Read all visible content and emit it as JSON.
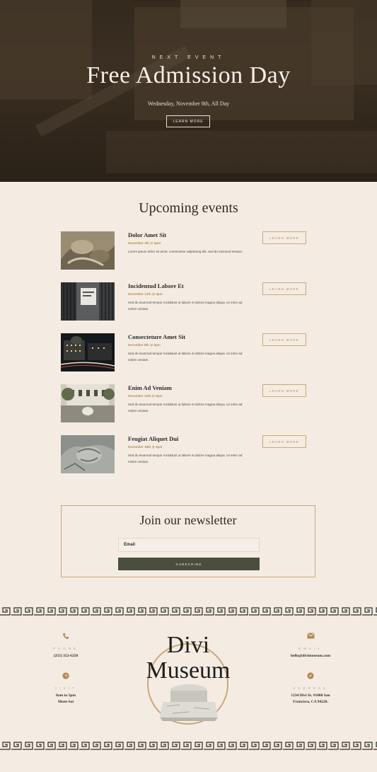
{
  "hero": {
    "kicker": "NEXT EVENT",
    "title": "Free Admission Day",
    "subtitle": "Wednesday, November 8th, All Day",
    "button": "LEARN MORE"
  },
  "events_section": {
    "title": "Upcoming events",
    "items": [
      {
        "name": "Dolor Amet Sit",
        "date": "November 4th @ 5pm",
        "desc": "Lorem ipsum dolor sit amet, consectetur adipiscing elit, sed do eiusmod tempor.",
        "button": "LEARN MORE"
      },
      {
        "name": "Incidentud Labore Et",
        "date": "November 12th @ 5pm",
        "desc": "Sed do eiusmod tempor incididunt ut labore et dolore magna aliqua. Ut enim ad minim veniam.",
        "button": "LEARN MORE"
      },
      {
        "name": "Consecteture Amet Sit",
        "date": "December 8th @ 5pm",
        "desc": "Sed do eiusmod tempor incididunt ut labore et dolore magna aliqua. Ut enim ad minim veniam.",
        "button": "LEARN MORE"
      },
      {
        "name": "Enim Ad Veniam",
        "date": "December 12th @ 5pm",
        "desc": "Sed do eiusmod tempor incididunt ut labore et dolore magna aliqua. Ut enim ad minim veniam.",
        "button": "LEARN MORE"
      },
      {
        "name": "Feugiat Aliquet Dui",
        "date": "December 18th @ 5pm",
        "desc": "Sed do eiusmod tempor incididunt ut labore et dolore magna aliqua. Ut enim ad minim veniam.",
        "button": "LEARN MORE"
      }
    ]
  },
  "newsletter": {
    "title": "Join our newsletter",
    "email_placeholder": "Email",
    "button": "SUBSCRIBE"
  },
  "footer": {
    "logo_line1": "Divi",
    "logo_line2": "Museum",
    "phone_label": "PHONE",
    "phone_value": "(255) 352-6258",
    "email_label": "EMAIL",
    "email_value": "hello@divimuseum.com",
    "visit_label": "VISIT",
    "visit_line1": "8am to 5pm",
    "visit_line2": "Mont-Sat",
    "address_label": "ADDRESS",
    "address_line1": "1234 Divi St. #1000 San",
    "address_line2": "Francisco, CA 94220."
  },
  "colors": {
    "background": "#f4ece3",
    "accent_gold": "#b48a52",
    "border_gold": "#c9a87a",
    "button_dark": "#4a4f3d",
    "text_dark": "#2b2a26"
  },
  "icons": [
    "phone-icon",
    "envelope-icon",
    "clock-icon",
    "compass-icon"
  ]
}
